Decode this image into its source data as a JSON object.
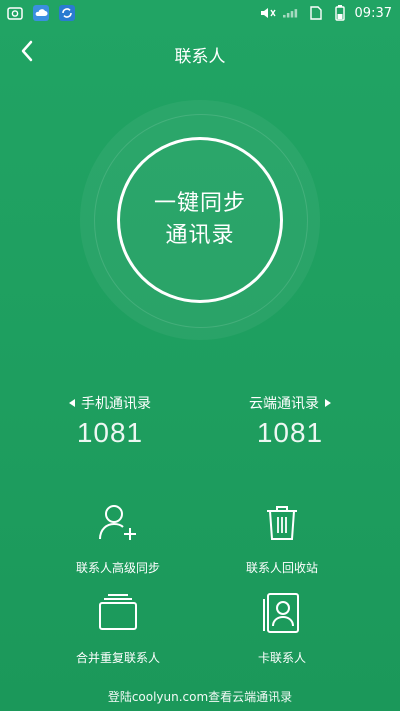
{
  "status_bar": {
    "time": "09:37"
  },
  "header": {
    "title": "联系人"
  },
  "sync": {
    "line1": "一键同步",
    "line2": "通讯录"
  },
  "stats": {
    "phone": {
      "label": "手机通讯录",
      "count": "1081"
    },
    "cloud": {
      "label": "云端通讯录",
      "count": "1081"
    }
  },
  "actions": [
    {
      "label": "联系人高级同步",
      "icon": "add-person-icon"
    },
    {
      "label": "联系人回收站",
      "icon": "trash-icon"
    },
    {
      "label": "合并重复联系人",
      "icon": "merge-cards-icon"
    },
    {
      "label": "卡联系人",
      "icon": "sim-contact-icon"
    }
  ],
  "footer": {
    "text": "登陆coolyun.com查看云端通讯录"
  },
  "colors": {
    "background": "#1e9e5f",
    "foreground": "#ffffff"
  }
}
